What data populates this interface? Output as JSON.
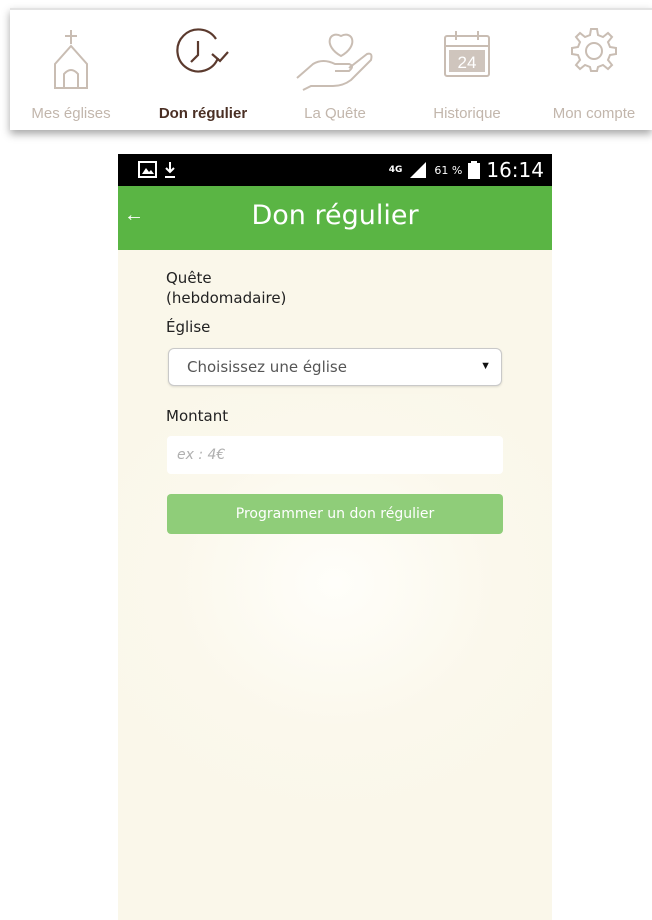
{
  "tabs": [
    {
      "label": "Mes églises",
      "icon": "church-icon",
      "active": false
    },
    {
      "label": "Don régulier",
      "icon": "clock-arrow-icon",
      "active": true
    },
    {
      "label": "La Quête",
      "icon": "heart-hand-icon",
      "active": false
    },
    {
      "label": "Historique",
      "icon": "calendar-icon",
      "active": false,
      "calendar_day": "24"
    },
    {
      "label": "Mon compte",
      "icon": "gear-icon",
      "active": false
    }
  ],
  "status_bar": {
    "network": "4G",
    "battery_percent": "61 %",
    "time": "16:14"
  },
  "app_bar": {
    "back_icon": "←",
    "title": "Don régulier"
  },
  "form": {
    "subtitle_line1": "Quête",
    "subtitle_line2": "(hebdomadaire)",
    "church_label": "Église",
    "church_select_value": "Choisissez une église",
    "amount_label": "Montant",
    "amount_placeholder": "ex : 4€",
    "amount_value": "",
    "submit_label": "Programmer un don régulier"
  },
  "colors": {
    "accent_green": "#5ab544",
    "button_green": "#8fcd79",
    "active_tab_brown": "#4a2f24",
    "inactive_tab": "#c2b6ac",
    "background_cream": "#faf7ea"
  }
}
